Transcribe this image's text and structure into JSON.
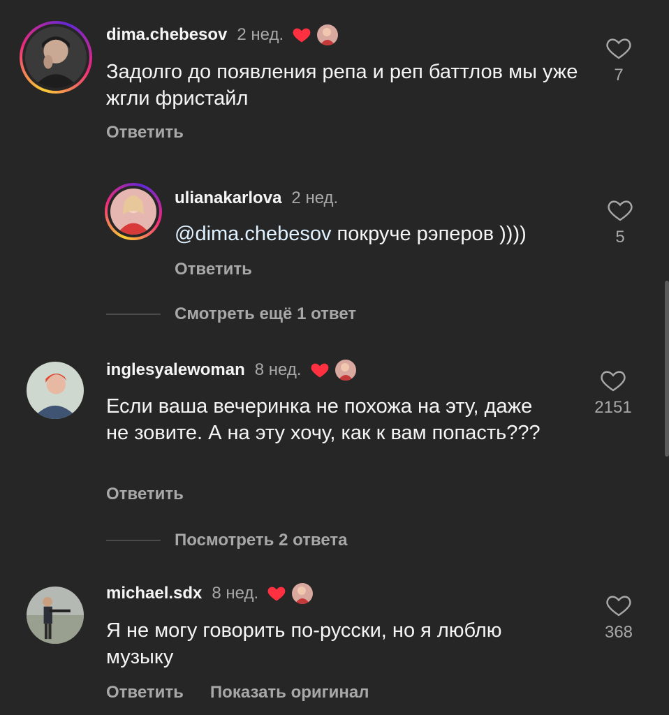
{
  "comments": [
    {
      "username": "dima.chebesov",
      "time": "2 нед.",
      "text": "Задолго до появления репа и реп баттлов мы уже жгли фристайл",
      "reply_label": "Ответить",
      "likes": "7"
    },
    {
      "username": "ulianakarlova",
      "time": "2 нед.",
      "mention": "@dima.chebesov",
      "text": " покруче рэперов ))))",
      "reply_label": "Ответить",
      "likes": "5"
    },
    {
      "username": "inglesyalewoman",
      "time": "8 нед.",
      "text": "Если ваша вечеринка не похожа на эту, даже не зовите. А на эту хочу, как к вам попасть???",
      "reply_label": "Ответить",
      "likes": "2151"
    },
    {
      "username": "michael.sdx",
      "time": "8 нед.",
      "text": "Я не могу говорить по-русски, но я люблю музыку",
      "reply_label": "Ответить",
      "show_original_label": "Показать оригинал",
      "likes": "368"
    }
  ],
  "view_more_1": "Смотреть ещё 1 ответ",
  "view_more_2": "Посмотреть 2 ответа",
  "colors": {
    "background": "#262626",
    "author_heart": "#ff3040",
    "secondary_text": "#a8a8a8"
  },
  "icons": {
    "like": "heart-outline-icon",
    "author_liked": "heart-filled-icon"
  }
}
